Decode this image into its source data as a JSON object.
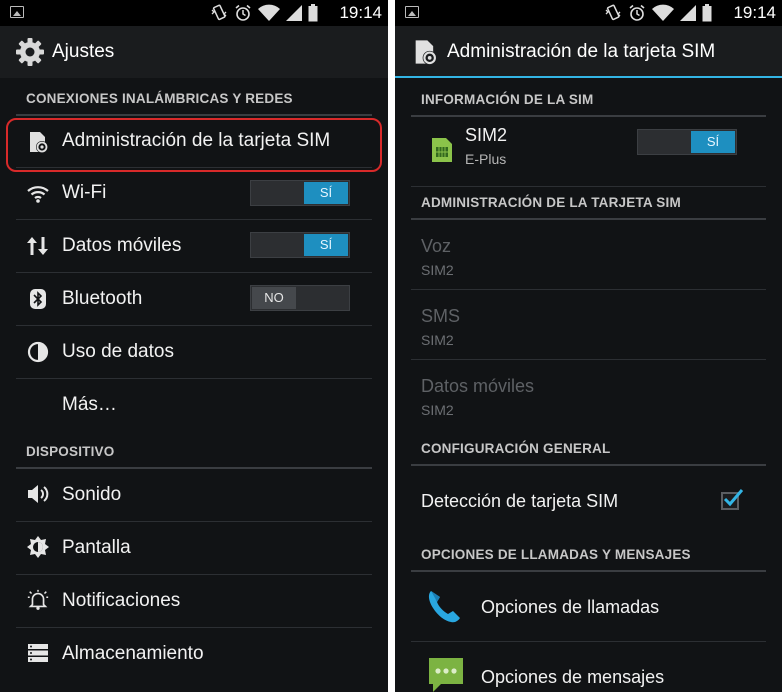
{
  "status": {
    "time": "19:14"
  },
  "left": {
    "title": "Ajustes",
    "sections": {
      "wireless": "CONEXIONES INALÁMBRICAS Y REDES",
      "device": "DISPOSITIVO"
    },
    "items": {
      "sim_admin": "Administración de la tarjeta SIM",
      "wifi": "Wi-Fi",
      "mobile_data": "Datos móviles",
      "bluetooth": "Bluetooth",
      "data_usage": "Uso de datos",
      "more": "Más…",
      "sound": "Sonido",
      "display": "Pantalla",
      "notifications": "Notificaciones",
      "storage": "Almacenamiento"
    },
    "toggles": {
      "wifi": "SÍ",
      "mobile_data": "SÍ",
      "bluetooth": "NO"
    }
  },
  "right": {
    "title": "Administración de la tarjeta SIM",
    "sections": {
      "sim_info": "INFORMACIÓN DE LA SIM",
      "sim_admin": "ADMINISTRACIÓN DE LA TARJETA SIM",
      "general": "CONFIGURACIÓN GENERAL",
      "call_options": "OPCIONES DE LLAMADAS Y MENSAJES"
    },
    "sim": {
      "name": "SIM2",
      "carrier": "E-Plus",
      "toggle": "SÍ"
    },
    "voice": {
      "title": "Voz",
      "value": "SIM2"
    },
    "sms": {
      "title": "SMS",
      "value": "SIM2"
    },
    "mobile_data": {
      "title": "Datos móviles",
      "value": "SIM2"
    },
    "detection": {
      "label": "Detección de tarjeta SIM"
    },
    "call_options": {
      "label": "Opciones de llamadas"
    },
    "message_options": {
      "label": "Opciones de mensajes"
    }
  },
  "colors": {
    "accent": "#33b5e5",
    "toggle_on": "#1e8fc0",
    "highlight": "#d82a2a"
  }
}
